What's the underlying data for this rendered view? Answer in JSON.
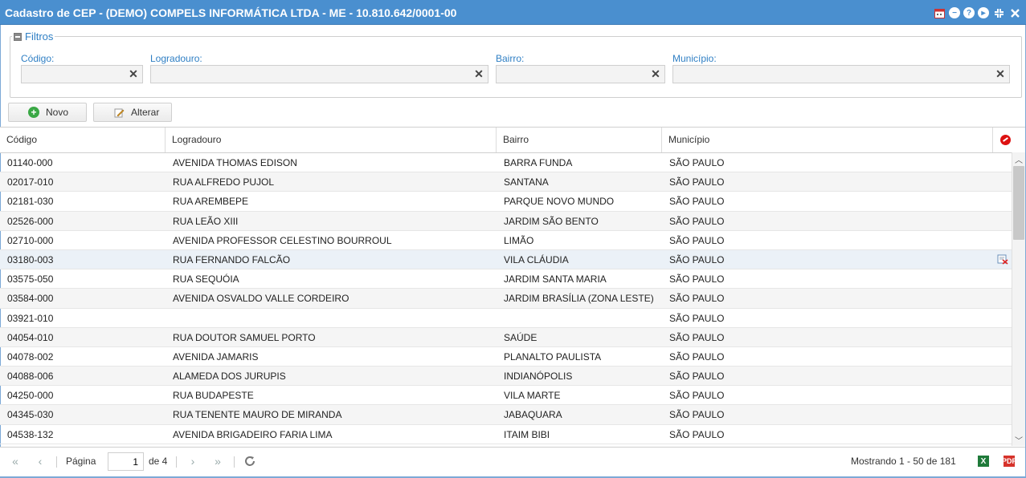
{
  "window": {
    "title": "Cadastro de CEP - (DEMO) COMPELS INFORMÁTICA LTDA - ME - 10.810.642/0001-00",
    "tools": [
      "calendar-icon",
      "minimize-icon",
      "help-icon",
      "play-icon",
      "collapse-icon",
      "close-icon"
    ]
  },
  "filters": {
    "legend": "Filtros",
    "fields": [
      {
        "label": "Código:",
        "value": ""
      },
      {
        "label": "Logradouro:",
        "value": ""
      },
      {
        "label": "Bairro:",
        "value": ""
      },
      {
        "label": "Município:",
        "value": ""
      }
    ]
  },
  "toolbar": {
    "new_label": "Novo",
    "edit_label": "Alterar"
  },
  "grid": {
    "columns": [
      "Código",
      "Logradouro",
      "Bairro",
      "Município"
    ],
    "rows": [
      {
        "codigo": "01140-000",
        "logradouro": "AVENIDA THOMAS EDISON",
        "bairro": "BARRA FUNDA",
        "municipio": "SÃO PAULO"
      },
      {
        "codigo": "02017-010",
        "logradouro": "RUA ALFREDO PUJOL",
        "bairro": "SANTANA",
        "municipio": "SÃO PAULO"
      },
      {
        "codigo": "02181-030",
        "logradouro": "RUA AREMBEPE",
        "bairro": "PARQUE NOVO MUNDO",
        "municipio": "SÃO PAULO"
      },
      {
        "codigo": "02526-000",
        "logradouro": "RUA LEÃO XIII",
        "bairro": "JARDIM SÃO BENTO",
        "municipio": "SÃO PAULO"
      },
      {
        "codigo": "02710-000",
        "logradouro": "AVENIDA PROFESSOR CELESTINO BOURROUL",
        "bairro": "LIMÃO",
        "municipio": "SÃO PAULO"
      },
      {
        "codigo": "03180-003",
        "logradouro": "RUA FERNANDO FALCÃO",
        "bairro": "VILA CLÁUDIA",
        "municipio": "SÃO PAULO"
      },
      {
        "codigo": "03575-050",
        "logradouro": "RUA SEQUÓIA",
        "bairro": "JARDIM SANTA MARIA",
        "municipio": "SÃO PAULO"
      },
      {
        "codigo": "03584-000",
        "logradouro": "AVENIDA OSVALDO VALLE CORDEIRO",
        "bairro": "JARDIM BRASÍLIA (ZONA LESTE)",
        "municipio": "SÃO PAULO"
      },
      {
        "codigo": "03921-010",
        "logradouro": "",
        "bairro": "",
        "municipio": "SÃO PAULO"
      },
      {
        "codigo": "04054-010",
        "logradouro": "RUA DOUTOR SAMUEL PORTO",
        "bairro": "SAÚDE",
        "municipio": "SÃO PAULO"
      },
      {
        "codigo": "04078-002",
        "logradouro": "AVENIDA JAMARIS",
        "bairro": "PLANALTO PAULISTA",
        "municipio": "SÃO PAULO"
      },
      {
        "codigo": "04088-006",
        "logradouro": "ALAMEDA DOS JURUPIS",
        "bairro": "INDIANÓPOLIS",
        "municipio": "SÃO PAULO"
      },
      {
        "codigo": "04250-000",
        "logradouro": "RUA BUDAPESTE",
        "bairro": "VILA MARTE",
        "municipio": "SÃO PAULO"
      },
      {
        "codigo": "04345-030",
        "logradouro": "RUA TENENTE MAURO DE MIRANDA",
        "bairro": "JABAQUARA",
        "municipio": "SÃO PAULO"
      },
      {
        "codigo": "04538-132",
        "logradouro": "AVENIDA BRIGADEIRO FARIA LIMA",
        "bairro": "ITAIM BIBI",
        "municipio": "SÃO PAULO"
      }
    ]
  },
  "pager": {
    "page_label": "Página",
    "page_value": "1",
    "of_label": "de 4",
    "summary": "Mostrando 1 - 50 de 181",
    "excel_icon": "X",
    "pdf_icon": "PDF"
  },
  "colors": {
    "titlebar": "#4a8fcf",
    "accent": "#2f7fc4"
  }
}
